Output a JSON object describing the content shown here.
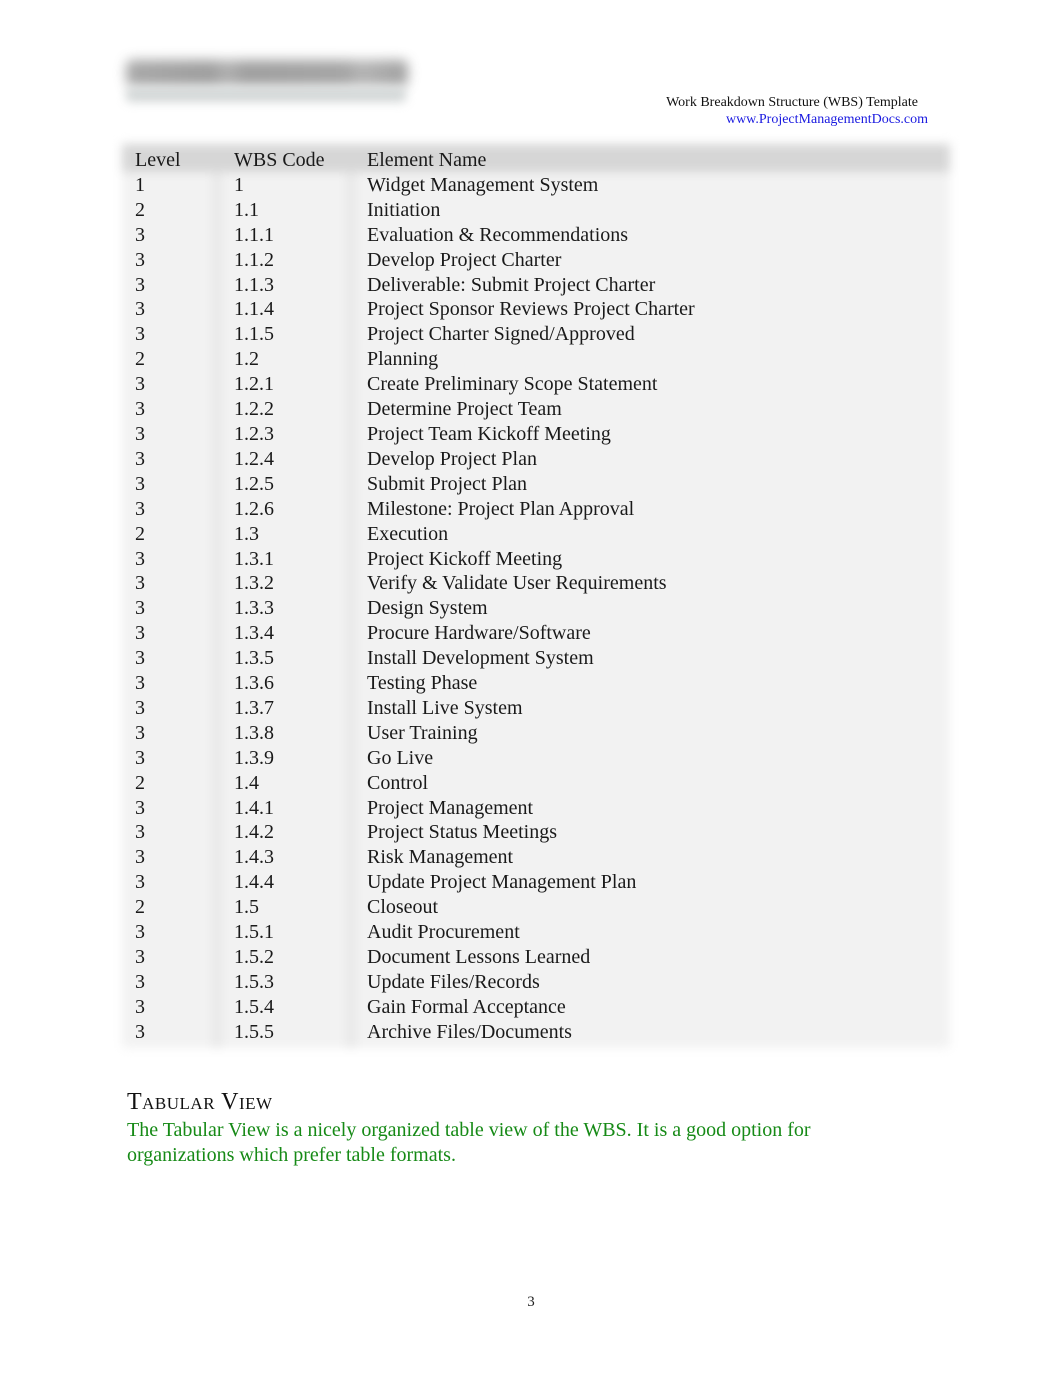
{
  "header": {
    "logo_name": "project-management-docs-logo",
    "title": "Work Breakdown Structure (WBS) Template",
    "link": "www.ProjectManagementDocs.com"
  },
  "table": {
    "columns": [
      "Level",
      "WBS Code",
      "Element Name"
    ],
    "rows": [
      {
        "level": "1",
        "code": "1",
        "name": "Widget Management System"
      },
      {
        "level": "2",
        "code": "1.1",
        "name": "Initiation"
      },
      {
        "level": "3",
        "code": "1.1.1",
        "name": "Evaluation & Recommendations"
      },
      {
        "level": "3",
        "code": "1.1.2",
        "name": "Develop Project Charter"
      },
      {
        "level": "3",
        "code": "1.1.3",
        "name": "Deliverable: Submit Project Charter"
      },
      {
        "level": "3",
        "code": "1.1.4",
        "name": "Project Sponsor Reviews Project Charter"
      },
      {
        "level": "3",
        "code": "1.1.5",
        "name": "Project Charter Signed/Approved"
      },
      {
        "level": "2",
        "code": "1.2",
        "name": "Planning"
      },
      {
        "level": "3",
        "code": "1.2.1",
        "name": "Create Preliminary Scope Statement"
      },
      {
        "level": "3",
        "code": "1.2.2",
        "name": "Determine Project Team"
      },
      {
        "level": "3",
        "code": "1.2.3",
        "name": "Project Team Kickoff Meeting"
      },
      {
        "level": "3",
        "code": "1.2.4",
        "name": "Develop Project Plan"
      },
      {
        "level": "3",
        "code": "1.2.5",
        "name": "Submit Project Plan"
      },
      {
        "level": "3",
        "code": "1.2.6",
        "name": "Milestone: Project Plan Approval"
      },
      {
        "level": "2",
        "code": "1.3",
        "name": "Execution"
      },
      {
        "level": "3",
        "code": "1.3.1",
        "name": "Project Kickoff Meeting"
      },
      {
        "level": "3",
        "code": "1.3.2",
        "name": "Verify & Validate User Requirements"
      },
      {
        "level": "3",
        "code": "1.3.3",
        "name": "Design System"
      },
      {
        "level": "3",
        "code": "1.3.4",
        "name": "Procure Hardware/Software"
      },
      {
        "level": "3",
        "code": "1.3.5",
        "name": "Install Development System"
      },
      {
        "level": "3",
        "code": "1.3.6",
        "name": "Testing Phase"
      },
      {
        "level": "3",
        "code": "1.3.7",
        "name": "Install Live System"
      },
      {
        "level": "3",
        "code": "1.3.8",
        "name": "User Training"
      },
      {
        "level": "3",
        "code": "1.3.9",
        "name": "Go Live"
      },
      {
        "level": "2",
        "code": "1.4",
        "name": "Control"
      },
      {
        "level": "3",
        "code": "1.4.1",
        "name": "Project Management"
      },
      {
        "level": "3",
        "code": "1.4.2",
        "name": "Project Status Meetings"
      },
      {
        "level": "3",
        "code": "1.4.3",
        "name": "Risk Management"
      },
      {
        "level": "3",
        "code": "1.4.4",
        "name": "Update Project Management Plan"
      },
      {
        "level": "2",
        "code": "1.5",
        "name": "Closeout"
      },
      {
        "level": "3",
        "code": "1.5.1",
        "name": "Audit Procurement"
      },
      {
        "level": "3",
        "code": "1.5.2",
        "name": "Document Lessons Learned"
      },
      {
        "level": "3",
        "code": "1.5.3",
        "name": "Update Files/Records"
      },
      {
        "level": "3",
        "code": "1.5.4",
        "name": "Gain Formal Acceptance"
      },
      {
        "level": "3",
        "code": "1.5.5",
        "name": "Archive Files/Documents"
      }
    ]
  },
  "section": {
    "title": "Tabular View",
    "body": "The Tabular View is a nicely organized table view of the WBS.   It is a good option for organizations which prefer table formats.",
    "body_color": "#168a16"
  },
  "footer": {
    "page_number": "3"
  }
}
